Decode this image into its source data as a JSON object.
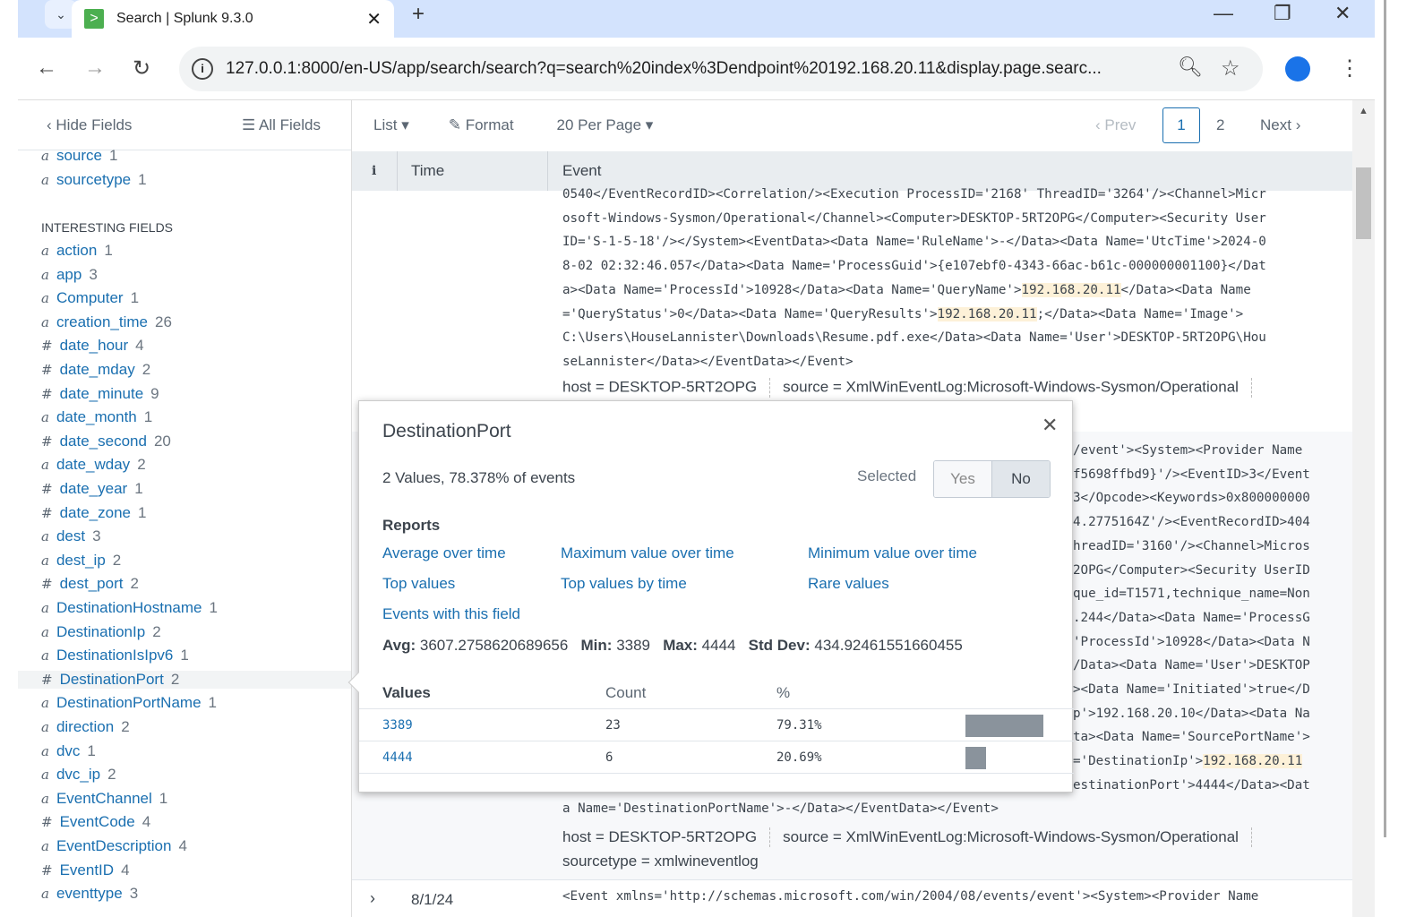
{
  "browser": {
    "tab_title": "Search | Splunk 9.3.0",
    "url": "127.0.0.1:8000/en-US/app/search/search?q=search%20index%3Dendpoint%20192.168.20.11&display.page.searc..."
  },
  "sidebar": {
    "hide_fields": "Hide Fields",
    "all_fields": "All Fields",
    "section_label": "INTERESTING FIELDS",
    "top_fields": [
      {
        "type": "a",
        "name": "source",
        "count": "1"
      },
      {
        "type": "a",
        "name": "sourcetype",
        "count": "1"
      }
    ],
    "fields": [
      {
        "type": "a",
        "name": "action",
        "count": "1"
      },
      {
        "type": "a",
        "name": "app",
        "count": "3"
      },
      {
        "type": "a",
        "name": "Computer",
        "count": "1"
      },
      {
        "type": "a",
        "name": "creation_time",
        "count": "26"
      },
      {
        "type": "#",
        "name": "date_hour",
        "count": "4"
      },
      {
        "type": "#",
        "name": "date_mday",
        "count": "2"
      },
      {
        "type": "#",
        "name": "date_minute",
        "count": "9"
      },
      {
        "type": "a",
        "name": "date_month",
        "count": "1"
      },
      {
        "type": "#",
        "name": "date_second",
        "count": "20"
      },
      {
        "type": "a",
        "name": "date_wday",
        "count": "2"
      },
      {
        "type": "#",
        "name": "date_year",
        "count": "1"
      },
      {
        "type": "#",
        "name": "date_zone",
        "count": "1"
      },
      {
        "type": "a",
        "name": "dest",
        "count": "3"
      },
      {
        "type": "a",
        "name": "dest_ip",
        "count": "2"
      },
      {
        "type": "#",
        "name": "dest_port",
        "count": "2"
      },
      {
        "type": "a",
        "name": "DestinationHostname",
        "count": "1"
      },
      {
        "type": "a",
        "name": "DestinationIp",
        "count": "2"
      },
      {
        "type": "a",
        "name": "DestinationIsIpv6",
        "count": "1"
      },
      {
        "type": "#",
        "name": "DestinationPort",
        "count": "2"
      },
      {
        "type": "a",
        "name": "DestinationPortName",
        "count": "1"
      },
      {
        "type": "a",
        "name": "direction",
        "count": "2"
      },
      {
        "type": "a",
        "name": "dvc",
        "count": "1"
      },
      {
        "type": "a",
        "name": "dvc_ip",
        "count": "2"
      },
      {
        "type": "a",
        "name": "EventChannel",
        "count": "1"
      },
      {
        "type": "#",
        "name": "EventCode",
        "count": "4"
      },
      {
        "type": "a",
        "name": "EventDescription",
        "count": "4"
      },
      {
        "type": "#",
        "name": "EventID",
        "count": "4"
      },
      {
        "type": "a",
        "name": "eventtype",
        "count": "3"
      }
    ]
  },
  "toolbar": {
    "list": "List",
    "format": "Format",
    "per_page": "20 Per Page",
    "prev": "Prev",
    "page1": "1",
    "page2": "2",
    "next": "Next"
  },
  "table": {
    "info_col": "i",
    "time_col": "Time",
    "event_col": "Event"
  },
  "event1": {
    "lines": [
      [
        "0540</EventRecordID><Correlation/><Execution ProcessID='2168' ThreadID='3264'/><Channel>Micr"
      ],
      [
        "osoft-Windows-Sysmon/Operational</Channel><Computer>DESKTOP-5RT2OPG</Computer><Security User"
      ],
      [
        "ID='S-1-5-18'/></System><EventData><Data Name='RuleName'>-</Data><Data Name='UtcTime'>2024-0"
      ],
      [
        "8-02 02:32:46.057</Data><Data Name='ProcessGuid'>{e107ebf0-4343-66ac-b61c-000000001100}</Dat"
      ],
      [
        "a><Data Name='ProcessId'>10928</Data><Data Name='QueryName'>",
        "192.168.20.11",
        "</Data><Data Name"
      ],
      [
        "='QueryStatus'>0</Data><Data Name='QueryResults'>",
        "192.168.20.11",
        ";</Data><Data Name='Image'>"
      ],
      [
        "C:\\Users\\HouseLannister\\Downloads\\Resume.pdf.exe</Data><Data Name='User'>DESKTOP-5RT2OPG\\Hou"
      ],
      [
        "seLannister</Data></EventData></Event>"
      ]
    ],
    "host": "host = DESKTOP-5RT2OPG",
    "source": "source = XmlWinEventLog:Microsoft-Windows-Sysmon/Operational"
  },
  "event2": {
    "fragments": [
      "/event'><System><Provider Name",
      "f5698ffbd9}'/><EventID>3</Event",
      "3</Opcode><Keywords>0x800000000",
      "4.2775164Z'/><EventRecordID>404",
      "hreadID='3160'/><Channel>Micros",
      "2OPG</Computer><Security UserID",
      "que_id=T1571,technique_name=Non",
      ".244</Data><Data Name='ProcessG",
      "'ProcessId'>10928</Data><Data N",
      "/Data><Data Name='User'>DESKTOP",
      "><Data Name='Initiated'>true</D",
      "p'>192.168.20.10</Data><Data Na",
      "ta><Data Name='SourcePortName'>",
      "='DestinationIp'>",
      "estinationPort'>4444</Data><Dat"
    ],
    "highlight": "192.168.20.11",
    "last_line": "a Name='DestinationPortName'>-</Data></EventData></Event>",
    "host": "host = DESKTOP-5RT2OPG",
    "source": "source = XmlWinEventLog:Microsoft-Windows-Sysmon/Operational",
    "sourcetype": "sourcetype = xmlwineventlog"
  },
  "event3": {
    "time": "8/1/24",
    "line": "<Event xmlns='http://schemas.microsoft.com/win/2004/08/events/event'><System><Provider Name"
  },
  "popup": {
    "title": "DestinationPort",
    "summary": "2 Values, 78.378% of events",
    "selected_label": "Selected",
    "yes": "Yes",
    "no": "No",
    "reports_label": "Reports",
    "reports": [
      "Average over time",
      "Maximum value over time",
      "Minimum value over time",
      "Top values",
      "Top values by time",
      "Rare values",
      "Events with this field"
    ],
    "stats": {
      "avg_label": "Avg:",
      "avg": "3607.2758620689656",
      "min_label": "Min:",
      "min": "3389",
      "max_label": "Max:",
      "max": "4444",
      "std_label": "Std Dev:",
      "std": "434.92461551660455"
    },
    "headers": {
      "values": "Values",
      "count": "Count",
      "pct": "%"
    },
    "rows": [
      {
        "value": "3389",
        "count": "23",
        "pct": "79.31%",
        "fraction": 0.7931
      },
      {
        "value": "4444",
        "count": "6",
        "pct": "20.69%",
        "fraction": 0.2069
      }
    ]
  }
}
